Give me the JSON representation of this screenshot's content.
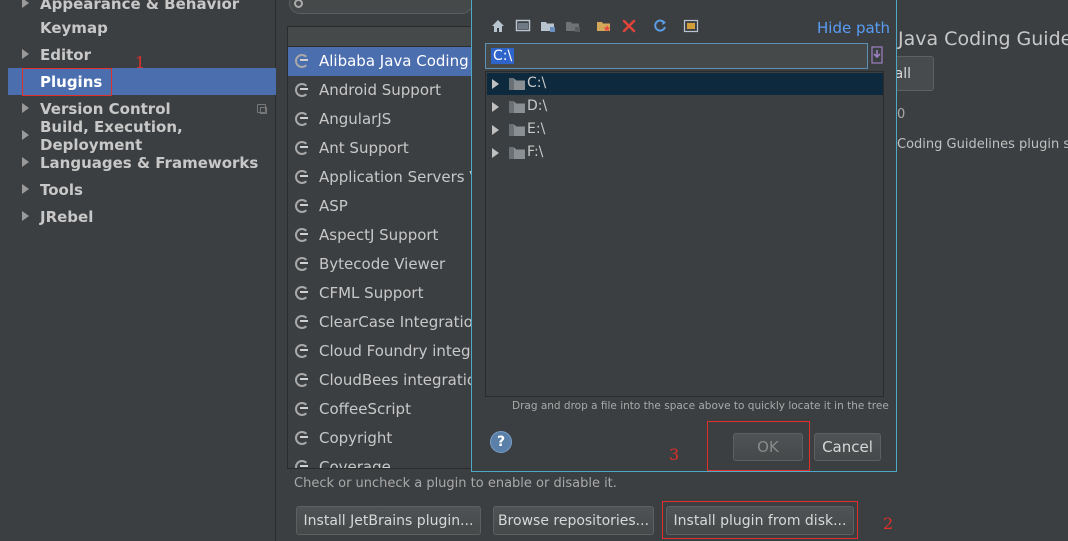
{
  "sidebar": {
    "items": [
      {
        "label": "Appearance & Behavior",
        "expandable": true
      },
      {
        "label": "Keymap",
        "expandable": false
      },
      {
        "label": "Editor",
        "expandable": true
      },
      {
        "label": "Plugins",
        "expandable": false,
        "selected": true
      },
      {
        "label": "Version Control",
        "expandable": true
      },
      {
        "label": "Build, Execution, Deployment",
        "expandable": true
      },
      {
        "label": "Languages & Frameworks",
        "expandable": true
      },
      {
        "label": "Tools",
        "expandable": true
      },
      {
        "label": "JRebel",
        "expandable": true
      }
    ]
  },
  "annotations": {
    "n1": "1",
    "n2": "2",
    "n3": "3"
  },
  "plugins": {
    "items": [
      "Alibaba Java Coding Guidelines",
      "Android Support",
      "AngularJS",
      "Ant Support",
      "Application Servers View",
      "ASP",
      "AspectJ Support",
      "Bytecode Viewer",
      "CFML Support",
      "ClearCase Integration",
      "Cloud Foundry integration",
      "CloudBees integration",
      "CoffeeScript",
      "Copyright",
      "Coverage"
    ],
    "hint": "Check or uncheck a plugin to enable or disable it.",
    "buttons": {
      "install_jetbrains": "Install JetBrains plugin...",
      "browse": "Browse repositories...",
      "install_disk": "Install plugin from disk..."
    }
  },
  "detail": {
    "title": "Java Coding Guidelines",
    "button_label": "all",
    "version": "0",
    "description": "Coding Guidelines plugin support"
  },
  "dialog": {
    "hide_path": "Hide path",
    "path_value": "C:\\",
    "drives": [
      "C:\\",
      "D:\\",
      "E:\\",
      "F:\\"
    ],
    "drag_hint": "Drag and drop a file into the space above to quickly locate it in the tree",
    "help": "?",
    "ok": "OK",
    "cancel": "Cancel"
  },
  "colors": {
    "selection": "#4b6eaf",
    "annotation": "#e0302a",
    "link": "#589df6",
    "dialog_border": "#4fa8c4"
  }
}
